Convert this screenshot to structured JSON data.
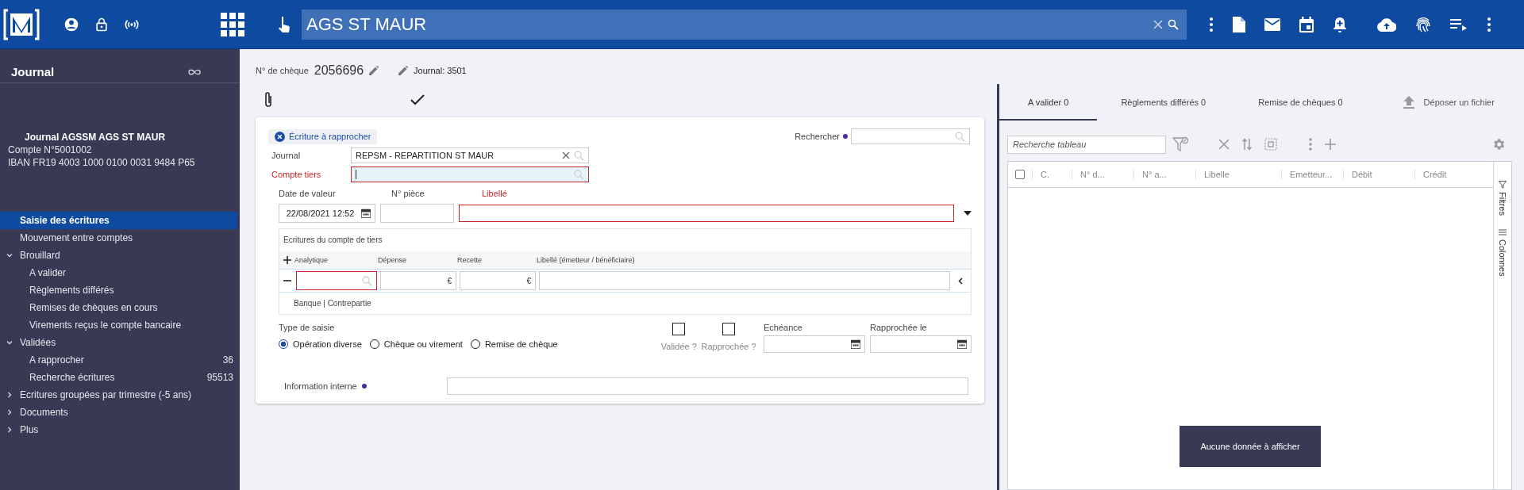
{
  "header": {
    "search_value": "AGS ST MAUR"
  },
  "sidebar": {
    "title": "Journal",
    "account": {
      "title": "Journal AGSSM AGS ST MAUR",
      "lines": [
        "Compte N°5001002",
        "IBAN FR19 4003 1000 0100 0031 9484 P65"
      ]
    },
    "items": [
      {
        "label": "Saisie des écritures",
        "selected": true
      },
      {
        "label": "Mouvement entre comptes",
        "selected": false
      },
      {
        "label": "Brouillard",
        "selected": false,
        "expanded": true,
        "children": [
          {
            "label": "A valider",
            "selected": false
          },
          {
            "label": "Règlements différés",
            "selected": false
          },
          {
            "label": "Remises de chèques en cours",
            "selected": false
          },
          {
            "label": "Virements reçus le compte bancaire",
            "selected": false
          }
        ]
      },
      {
        "label": "Validées",
        "selected": false,
        "expanded": true,
        "children": [
          {
            "label": "A rapprocher",
            "selected": false,
            "count": "36"
          },
          {
            "label": "Recherche écritures",
            "selected": false,
            "count": "95513"
          }
        ]
      },
      {
        "label": "Ecritures groupées par trimestre (-5 ans)",
        "selected": false,
        "expanded": false
      },
      {
        "label": "Documents",
        "selected": false,
        "expanded": false
      },
      {
        "label": "Plus",
        "selected": false,
        "expanded": false
      }
    ]
  },
  "info_bar": {
    "cheque_label": "N° de chèque",
    "cheque_number": "2056696",
    "journal": "Journal: 3501"
  },
  "form": {
    "chip": "Écriture à rapprocher",
    "search_label": "Rechercher",
    "journal": {
      "label": "Journal",
      "value": "REPSM - REPARTITION ST MAUR",
      "required": false
    },
    "compte_tiers": {
      "label": "Compte tiers",
      "required": true
    },
    "date": {
      "label": "Date de valeur",
      "value": "22/08/2021 12:52"
    },
    "piece": {
      "label": "N° pièce"
    },
    "libelle": {
      "label": "Libellé",
      "required": true
    },
    "entries": {
      "title": "Ecritures du compte de tiers",
      "columns": [
        "Analytique",
        "Dépense",
        "Recette",
        "Libellé (émetteur / bénéficiaire)"
      ],
      "currency": "€",
      "footer": "Banque | Contrepartie"
    },
    "type_label": "Type de saisie",
    "types": [
      {
        "label": "Opération diverse",
        "selected": true
      },
      {
        "label": "Chèque ou virement",
        "selected": false
      },
      {
        "label": "Remise de chèque",
        "selected": false
      }
    ],
    "checks": [
      {
        "label": "Validée ?",
        "checked": false
      },
      {
        "label": "Rapprochée ?",
        "checked": false
      }
    ],
    "echeance": "Echéance",
    "rapprochee_le": "Rapprochée le",
    "info_interne": "Information interne"
  },
  "right": {
    "tabs": [
      {
        "label": "A valider 0",
        "selected": true
      },
      {
        "label": "Règlements différés 0",
        "selected": false
      },
      {
        "label": "Remise de chèques 0",
        "selected": false
      }
    ],
    "upload": "Déposer un fichier",
    "select_all_checked": false,
    "table_search_placeholder": "Recherche tableau",
    "columns": [
      "C.",
      "N° d...",
      "N° a...",
      "Libelle",
      "Emetteur...",
      "Débit",
      "Crédit"
    ],
    "side_tabs": [
      "Filtres",
      "Colonnes"
    ],
    "empty": "Aucune donnée à afficher"
  }
}
